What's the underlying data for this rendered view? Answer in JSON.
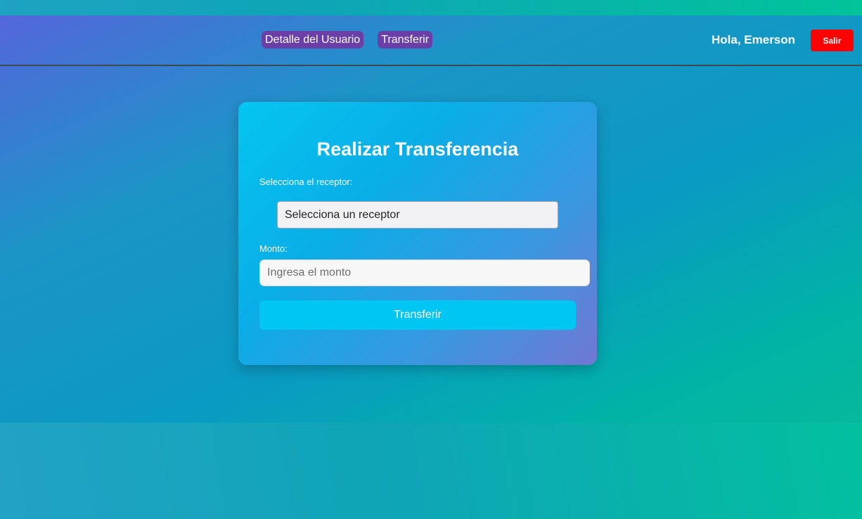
{
  "nav": {
    "links": [
      {
        "label": "Detalle del Usuario"
      },
      {
        "label": "Transferir"
      }
    ],
    "greeting": "Hola, Emerson",
    "logout_label": "Salir"
  },
  "transfer_form": {
    "title": "Realizar Transferencia",
    "receiver_label": "Selecciona el receptor:",
    "receiver_selected": "Selecciona un receptor",
    "amount_label": "Monto:",
    "amount_value": "",
    "amount_placeholder": "Ingresa el monto",
    "submit_label": "Transferir"
  },
  "colors": {
    "nav_link_bg": "#6a3fa8",
    "logout_bg": "#ff0000",
    "submit_bg": "#00c6f4"
  }
}
